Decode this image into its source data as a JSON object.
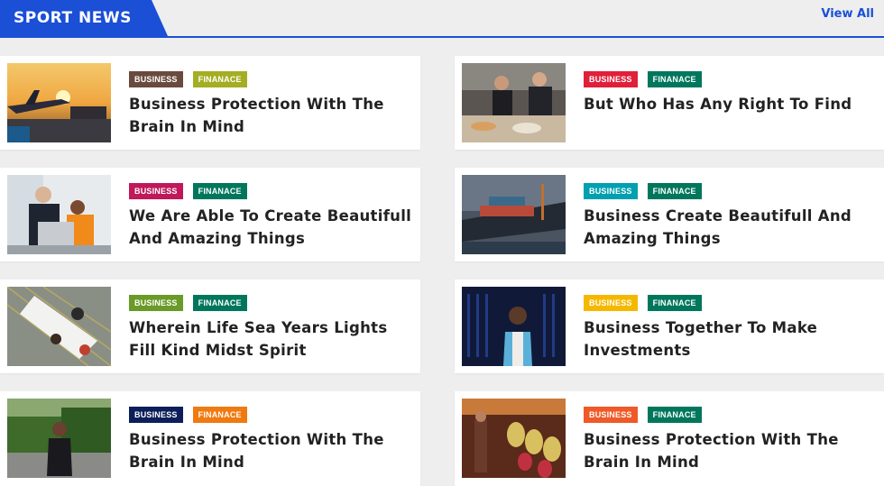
{
  "header": {
    "title": "SPORT NEWS",
    "view_all": "View All",
    "accent": "#1a4fd6"
  },
  "cards": [
    {
      "category": "BUSINESS",
      "category_color": "#6b4a3e",
      "tag2": "FINANACE",
      "tag2_color": "#a3ae22",
      "title": "Business Protection With The Brain In Mind",
      "image": "airport-sunset"
    },
    {
      "category": "BUSINESS",
      "category_color": "#e0203a",
      "tag2": "FINANACE",
      "tag2_color": "#00775c",
      "title": "But Who Has Any Right To Find",
      "image": "kitchen-chefs"
    },
    {
      "category": "BUSINESS",
      "category_color": "#c0185a",
      "tag2": "FINANACE",
      "tag2_color": "#00775c",
      "title": "We Are Able To Create Beautifull And Amazing Things",
      "image": "office-meeting"
    },
    {
      "category": "BUSINESS",
      "category_color": "#00a0b0",
      "tag2": "FINANACE",
      "tag2_color": "#00775c",
      "title": "Business Create Beautifull And Amazing Things",
      "image": "cargo-ship"
    },
    {
      "category": "BUSINESS",
      "category_color": "#6a9a28",
      "tag2": "FINANACE",
      "tag2_color": "#00775c",
      "title": "Wherein Life Sea Years Lights Fill Kind Midst Spirit",
      "image": "desk-overhead"
    },
    {
      "category": "BUSINESS",
      "category_color": "#f5b800",
      "tag2": "FINANACE",
      "tag2_color": "#00775c",
      "title": "Business Together To Make Investments",
      "image": "woman-server-room"
    },
    {
      "category": "BUSINESS",
      "category_color": "#0d1f5a",
      "tag2": "FINANACE",
      "tag2_color": "#f07a10",
      "title": "Business Protection With The Brain In Mind",
      "image": "woman-garden"
    },
    {
      "category": "BUSINESS",
      "category_color": "#ef5a28",
      "tag2": "FINANACE",
      "tag2_color": "#00775c",
      "title": "Business Protection With The Brain In Mind",
      "image": "market-stall"
    }
  ]
}
